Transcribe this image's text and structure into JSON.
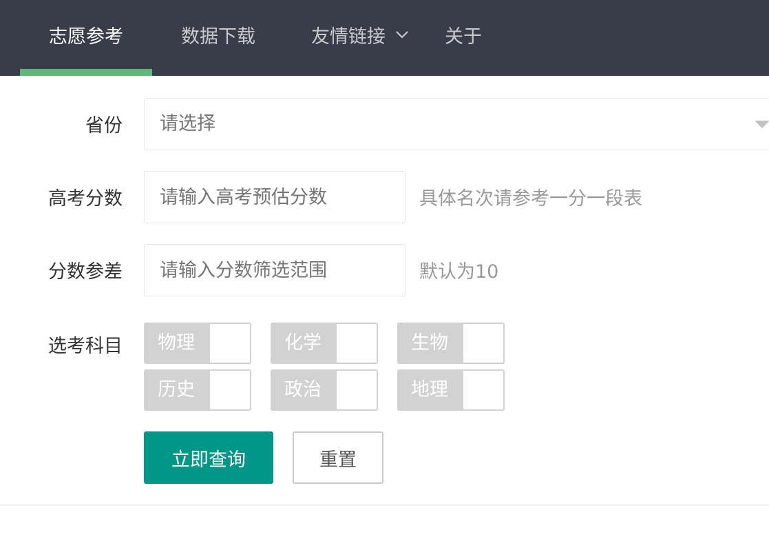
{
  "nav": {
    "items": [
      {
        "label": "志愿参考",
        "active": true
      },
      {
        "label": "数据下载",
        "active": false
      },
      {
        "label": "友情链接",
        "active": false,
        "has_dropdown": true
      },
      {
        "label": "关于",
        "active": false
      }
    ],
    "background_color": "#393d49",
    "active_indicator_color": "#5fb878"
  },
  "form": {
    "province": {
      "label": "省份",
      "selected": "请选择"
    },
    "score": {
      "label": "高考分数",
      "placeholder": "请输入高考预估分数",
      "value": "",
      "aux": "具体名次请参考一分一段表"
    },
    "score_range": {
      "label": "分数参差",
      "placeholder": "请输入分数筛选范围",
      "value": "",
      "aux": "默认为10"
    },
    "subjects": {
      "label": "选考科目",
      "options": [
        {
          "label": "物理",
          "checked": false
        },
        {
          "label": "化学",
          "checked": false
        },
        {
          "label": "生物",
          "checked": false
        },
        {
          "label": "历史",
          "checked": false
        },
        {
          "label": "政治",
          "checked": false
        },
        {
          "label": "地理",
          "checked": false
        }
      ]
    },
    "submit_label": "立即查询",
    "reset_label": "重置",
    "primary_color": "#009688"
  }
}
